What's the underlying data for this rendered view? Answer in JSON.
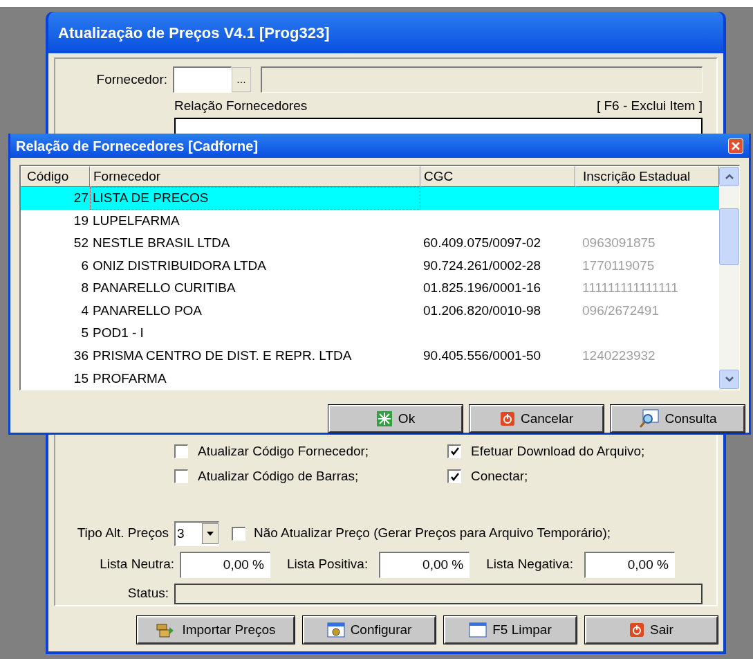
{
  "main_window": {
    "title": "Atualização de Preços V4.1 [Prog323]",
    "supplier": {
      "label": "Fornecedor:",
      "lookup_button": "..."
    },
    "supplier_list": {
      "label": "Relação Fornecedores",
      "hint": "[ F6 - Exclui Item ]"
    },
    "options": [
      {
        "label": "Atualizar Código Fornecedor;",
        "checked": false
      },
      {
        "label": "Efetuar Download do Arquivo;",
        "checked": true
      },
      {
        "label": "Atualizar Código de Barras;",
        "checked": false
      },
      {
        "label": "Conectar;",
        "checked": true
      }
    ],
    "price_type": {
      "label": "Tipo Alt. Preços",
      "value": "3"
    },
    "no_update": {
      "label": "Não Atualizar Preço (Gerar Preços para Arquivo Temporário);",
      "checked": false
    },
    "lists": [
      {
        "label": "Lista Neutra:",
        "value": "0,00 %"
      },
      {
        "label": "Lista Positiva:",
        "value": "0,00 %"
      },
      {
        "label": "Lista Negativa:",
        "value": "0,00 %"
      }
    ],
    "status": {
      "label": "Status:"
    },
    "buttons": [
      {
        "label": "Importar Preços",
        "kind": "import"
      },
      {
        "label": "Configurar",
        "kind": "config"
      },
      {
        "label": "F5 Limpar",
        "kind": "window"
      },
      {
        "label": "Sair",
        "kind": "exit"
      }
    ]
  },
  "dialog": {
    "title": "Relação de Fornecedores [Cadforne]",
    "columns": [
      "Código",
      "Fornecedor",
      "CGC",
      "Inscrição Estadual"
    ],
    "rows": [
      {
        "code": "27",
        "supplier": "LISTA DE PRECOS",
        "cgc": "",
        "ie": "",
        "selected": true
      },
      {
        "code": "19",
        "supplier": "LUPELFARMA",
        "cgc": "",
        "ie": "",
        "selected": false
      },
      {
        "code": "52",
        "supplier": "NESTLE BRASIL LTDA",
        "cgc": "60.409.075/0097-02",
        "ie": "0963091875",
        "selected": false
      },
      {
        "code": "6",
        "supplier": "ONIZ DISTRIBUIDORA LTDA",
        "cgc": "90.724.261/0002-28",
        "ie": "1770119075",
        "selected": false
      },
      {
        "code": "8",
        "supplier": "PANARELLO CURITIBA",
        "cgc": "01.825.196/0001-16",
        "ie": "111111111111111",
        "selected": false
      },
      {
        "code": "4",
        "supplier": "PANARELLO POA",
        "cgc": "01.206.820/0010-98",
        "ie": "096/2672491",
        "selected": false
      },
      {
        "code": "5",
        "supplier": "POD1 - I",
        "cgc": "",
        "ie": "",
        "selected": false
      },
      {
        "code": "36",
        "supplier": "PRISMA CENTRO DE DIST. E REPR. LTDA",
        "cgc": "90.405.556/0001-50",
        "ie": "1240223932",
        "selected": false
      },
      {
        "code": "15",
        "supplier": "PROFARMA",
        "cgc": "",
        "ie": "",
        "selected": false
      }
    ],
    "buttons": [
      {
        "label": "Ok",
        "kind": "ok"
      },
      {
        "label": "Cancelar",
        "kind": "exit"
      },
      {
        "label": "Consulta",
        "kind": "search"
      }
    ]
  }
}
